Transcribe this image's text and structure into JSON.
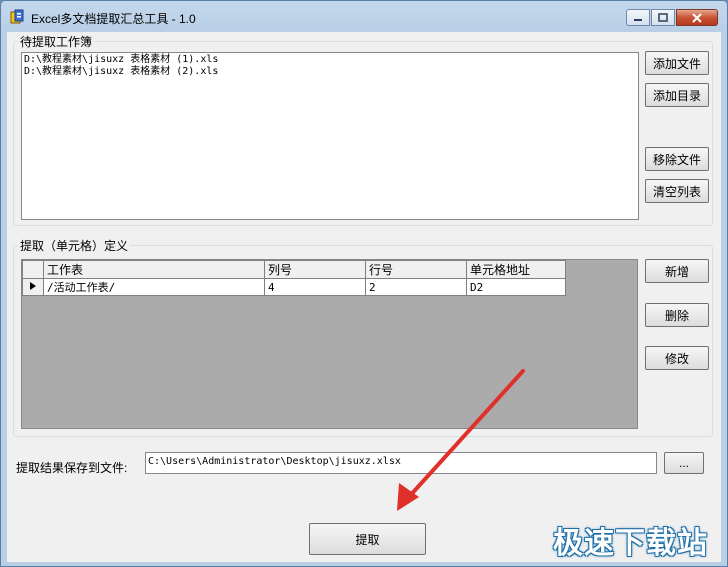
{
  "window": {
    "title": "Excel多文档提取汇总工具 - 1.0",
    "controls": {
      "minimize": "minimize",
      "maximize": "maximize",
      "close": "close"
    }
  },
  "workbooks": {
    "group_title": "待提取工作簿",
    "files": [
      "D:\\教程素材\\jisuxz 表格素材 (1).xls",
      "D:\\教程素材\\jisuxz 表格素材 (2).xls"
    ],
    "buttons": {
      "add_file": "添加文件",
      "add_dir": "添加目录",
      "remove_file": "移除文件",
      "clear_list": "清空列表"
    }
  },
  "extract": {
    "group_title": "提取（单元格）定义",
    "columns": [
      "工作表",
      "列号",
      "行号",
      "单元格地址"
    ],
    "rows": [
      {
        "sheet": "/活动工作表/",
        "col": "4",
        "row": "2",
        "address": "D2"
      }
    ],
    "buttons": {
      "add": "新增",
      "delete": "删除",
      "modify": "修改"
    }
  },
  "save": {
    "label": "提取结果保存到文件:",
    "path": "C:\\Users\\Administrator\\Desktop\\jisuxz.xlsx",
    "browse": "..."
  },
  "run_button": "提取",
  "watermark": "极速下载站",
  "colors": {
    "annotation_arrow": "#e0302a",
    "watermark_outline": "#1f6fa8"
  }
}
